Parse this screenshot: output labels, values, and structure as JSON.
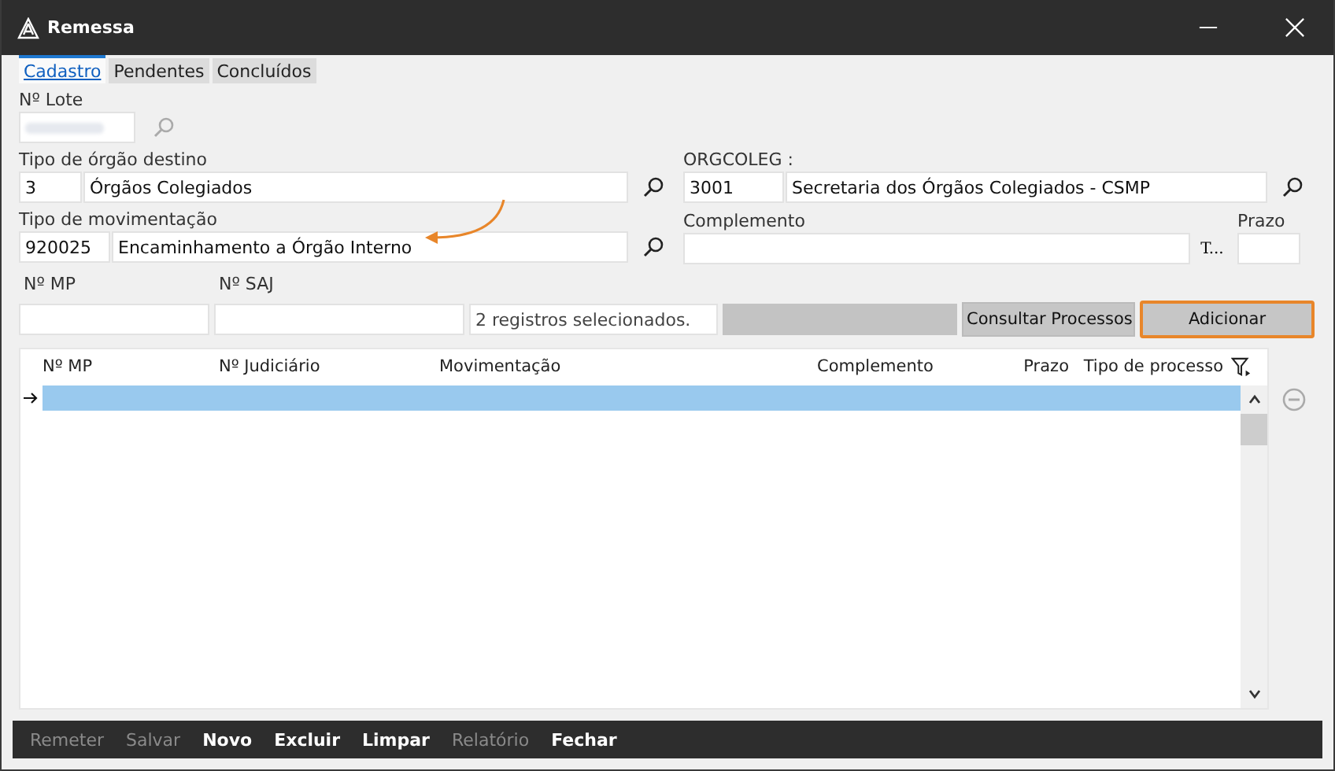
{
  "window": {
    "title": "Remessa"
  },
  "tabs": [
    {
      "label": "Cadastro",
      "selected": true
    },
    {
      "label": "Pendentes",
      "selected": false
    },
    {
      "label": "Concluídos",
      "selected": false
    }
  ],
  "lote": {
    "label": "Nº Lote"
  },
  "orgao_destino": {
    "label": "Tipo de órgão destino",
    "code": "3",
    "name": "Órgãos Colegiados"
  },
  "orgcoleg": {
    "label": "ORGCOLEG :",
    "code": "3001",
    "name": "Secretaria dos Órgãos Colegiados - CSMP"
  },
  "movimentacao": {
    "label": "Tipo de movimentação",
    "code": "920025",
    "name": "Encaminhamento a Órgão Interno"
  },
  "complemento": {
    "label": "Complemento",
    "button": "T..."
  },
  "prazo": {
    "label": "Prazo"
  },
  "mp": {
    "label": "Nº MP"
  },
  "saj": {
    "label": "Nº SAJ"
  },
  "selection_info": "2 registros selecionados.",
  "actions": [
    {
      "label": "Consultar Processos",
      "highlighted": false
    },
    {
      "label": "Adicionar",
      "highlighted": true
    }
  ],
  "table": {
    "columns": [
      "Nº MP",
      "Nº Judiciário",
      "Movimentação",
      "Complemento",
      "Prazo",
      "Tipo de processo"
    ],
    "rows": [
      {
        "selected": true
      }
    ]
  },
  "footer": [
    {
      "label": "Remeter",
      "disabled": true
    },
    {
      "label": "Salvar",
      "disabled": true
    },
    {
      "label": "Novo",
      "disabled": false
    },
    {
      "label": "Excluir",
      "disabled": false
    },
    {
      "label": "Limpar",
      "disabled": false
    },
    {
      "label": "Relatório",
      "disabled": true
    },
    {
      "label": "Fechar",
      "disabled": false
    }
  ]
}
